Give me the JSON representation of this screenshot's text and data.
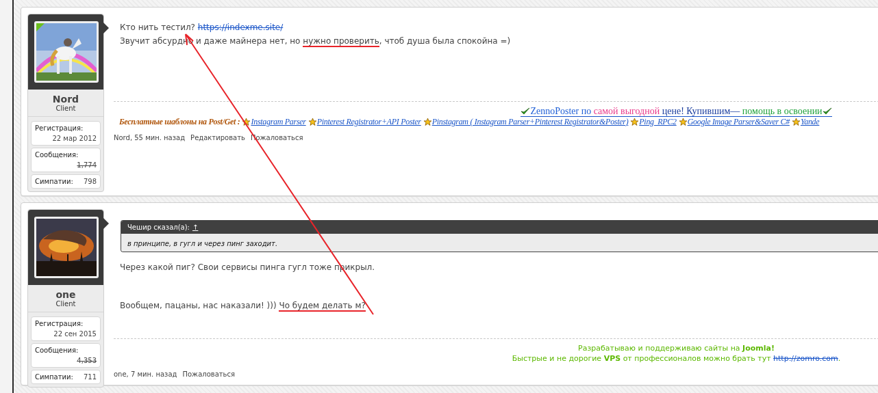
{
  "posts": [
    {
      "user": {
        "name": "Nord",
        "title": "Client",
        "online": true,
        "stats": [
          {
            "label": "Регистрация:",
            "value": "22 мар 2012",
            "struck": false
          },
          {
            "label": "Сообщения:",
            "value": "1,774",
            "struck": true
          },
          {
            "label": "Симпатии:",
            "value": "798",
            "struck": false
          }
        ]
      },
      "paragraphs": [
        {
          "segments": [
            {
              "kind": "text",
              "text": "Кто нить тестил? "
            },
            {
              "kind": "link",
              "text": "https://indexme.site/"
            }
          ]
        },
        {
          "segments": [
            {
              "kind": "text",
              "text": "Звучит абсурдно и даже майнера нет, но "
            },
            {
              "kind": "marked",
              "text": "нужно проверить"
            },
            {
              "kind": "text",
              "text": ", чтоб душа была спокойна =)"
            }
          ]
        }
      ],
      "signature": {
        "kind": "banner",
        "lines": [
          {
            "items": [
              {
                "kind": "tick"
              },
              {
                "kind": "text",
                "text": "ZennoPoster по",
                "color": "#1f5fd6"
              },
              {
                "kind": "text",
                "text": " самой выгодной",
                "color": "#e8388a"
              },
              {
                "kind": "text",
                "text": " цене! Купившим—",
                "color": "#1a3d9e"
              },
              {
                "kind": "text",
                "text": " помощь в освоении",
                "color": "#1fa23a"
              },
              {
                "kind": "tick"
              }
            ]
          },
          {
            "items": [
              {
                "kind": "heading",
                "text": "Бесплатные шаблоны на Post/Get :",
                "color": "#b0560c"
              },
              {
                "kind": "star"
              },
              {
                "kind": "link",
                "text": "Instagram Parser"
              },
              {
                "kind": "star"
              },
              {
                "kind": "link",
                "text": "Pinterest Registrator+API Poster"
              },
              {
                "kind": "star"
              },
              {
                "kind": "link",
                "text": "Pinstagram ( Instagram Parser+Pinterest Registrator&Poster)"
              },
              {
                "kind": "star"
              },
              {
                "kind": "link",
                "text": "Ping  RPC2"
              },
              {
                "kind": "star"
              },
              {
                "kind": "link",
                "text": "Google Image Parser&Saver C#"
              },
              {
                "kind": "star"
              },
              {
                "kind": "link",
                "text": "Yande"
              }
            ]
          }
        ]
      },
      "meta": {
        "byline": "Nord, 55 мин. назад",
        "actions": [
          "Редактировать",
          "Пожаловаться"
        ]
      }
    },
    {
      "user": {
        "name": "one",
        "title": "Client",
        "online": false,
        "stats": [
          {
            "label": "Регистрация:",
            "value": "22 сен 2015",
            "struck": false
          },
          {
            "label": "Сообщения:",
            "value": "4,353",
            "struck": true
          },
          {
            "label": "Симпатии:",
            "value": "711",
            "struck": false
          }
        ]
      },
      "quote": {
        "author": "Чешир сказал(а):",
        "jump": "↑",
        "text": "в принципе, в гугл и через пинг заходит."
      },
      "paragraphs": [
        {
          "segments": [
            {
              "kind": "text",
              "text": "Через какой пиг? Свои сервисы пинга гугл тоже прикрыл."
            }
          ]
        },
        {
          "segments": [
            {
              "kind": "text",
              "text": "Вообщем, пацаны, нас наказали! ))) "
            },
            {
              "kind": "marked",
              "text": "Чо будем делать м?"
            }
          ]
        }
      ],
      "signature": {
        "kind": "plain",
        "lines": [
          {
            "items": [
              {
                "kind": "text",
                "text": "Разрабатываю и поддерживаю сайты на **Joomla!**",
                "color": "#5cb800"
              }
            ]
          },
          {
            "items": [
              {
                "kind": "text",
                "text": "Быстрые и не дорогие **VPS** от профессионалов можно брать тут ",
                "color": "#5cb800"
              },
              {
                "kind": "link",
                "text": "http://zomro.com"
              },
              {
                "kind": "text",
                "text": "."
              }
            ]
          }
        ]
      },
      "meta": {
        "byline": "one, 7 мин. назад",
        "actions": [
          "Пожаловаться"
        ]
      }
    }
  ]
}
